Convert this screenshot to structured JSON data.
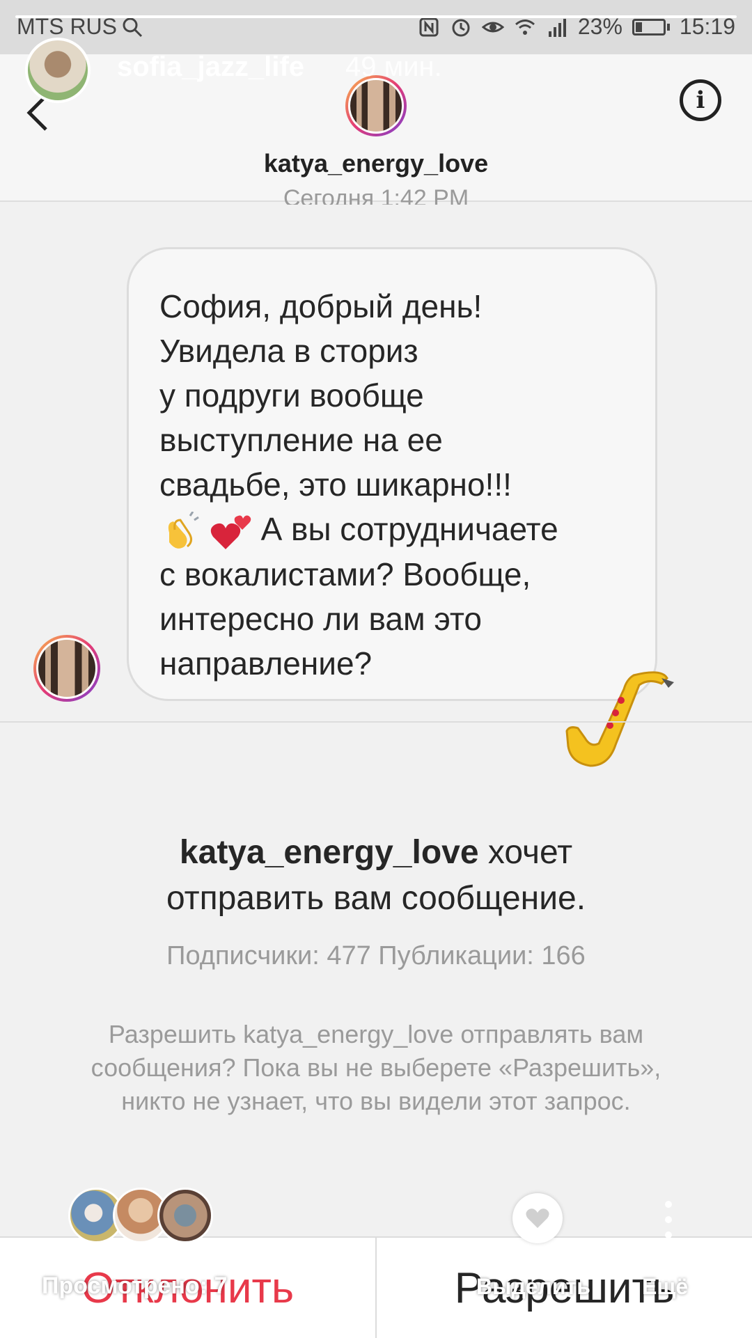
{
  "status_bar": {
    "carrier": "MTS RUS",
    "battery": "23%",
    "battery_level": 0.23,
    "time": "15:19"
  },
  "story": {
    "progress": 1.0,
    "username": "sofia_jazz_life",
    "time_ago": "49 мин."
  },
  "dm_header": {
    "username": "katya_energy_love"
  },
  "conversation": {
    "date_separator": "Сегодня 1:42 PM",
    "message_lines": [
      "София, добрый день!",
      "Увидела в сториз",
      "у подруги вообще",
      "выступление на ее",
      "свадьбе, это шикарно!!!",
      "А вы сотрудничаете",
      "с вокалистами? Вообще,",
      "интересно ли вам это",
      "направление?"
    ]
  },
  "request": {
    "username": "katya_energy_love",
    "title_rest_1": "хочет",
    "title_line_2": "отправить вам сообщение.",
    "stats": "Подписчики: 477 Публикации: 166",
    "note": "Разрешить katya_energy_love отправлять вам сообщения? Пока вы не выберете «Разрешить», никто не узнает, что вы видели этот запрос."
  },
  "actions": {
    "decline": "Отклонить",
    "allow": "Разрешить"
  },
  "story_footer": {
    "viewed": "Просмотрено: 7",
    "highlight": "Выделить",
    "more": "Ещё"
  },
  "colors": {
    "decline": "#e8394a",
    "accent_gradient": [
      "#f9b84b",
      "#e33b76",
      "#7b3fd0"
    ]
  }
}
